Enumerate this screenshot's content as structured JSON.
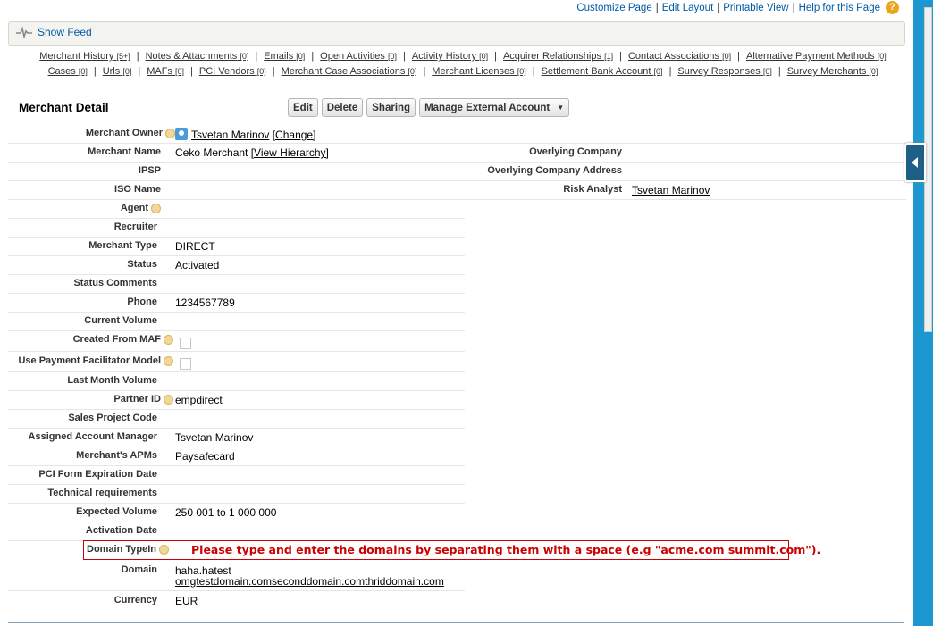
{
  "top_links": [
    "Customize Page",
    "Edit Layout",
    "Printable View",
    "Help for this Page"
  ],
  "feed": {
    "show_feed_label": "Show Feed"
  },
  "related_links_row1": [
    {
      "label": "Merchant History",
      "count": "[5+]"
    },
    {
      "label": "Notes & Attachments",
      "count": "[0]"
    },
    {
      "label": "Emails",
      "count": "[0]"
    },
    {
      "label": "Open Activities",
      "count": "[0]"
    },
    {
      "label": "Activity History",
      "count": "[0]"
    },
    {
      "label": "Acquirer Relationships",
      "count": "[1]"
    },
    {
      "label": "Contact Associations",
      "count": "[0]"
    },
    {
      "label": "Alternative Payment Methods",
      "count": "[0]"
    }
  ],
  "related_links_row2": [
    {
      "label": "Cases",
      "count": "[0]"
    },
    {
      "label": "Urls",
      "count": "[0]"
    },
    {
      "label": "MAFs",
      "count": "[0]"
    },
    {
      "label": "PCI Vendors",
      "count": "[0]"
    },
    {
      "label": "Merchant Case Associations",
      "count": "[0]"
    },
    {
      "label": "Merchant Licenses",
      "count": "[0]"
    },
    {
      "label": "Settlement Bank Account",
      "count": "[0]"
    },
    {
      "label": "Survey Responses",
      "count": "[0]"
    },
    {
      "label": "Survey Merchants",
      "count": "[0]"
    }
  ],
  "detail": {
    "title": "Merchant Detail",
    "buttons": {
      "edit": "Edit",
      "delete": "Delete",
      "sharing": "Sharing",
      "manage": "Manage External Account"
    }
  },
  "fields": {
    "owner": {
      "label": "Merchant Owner",
      "value": "Tsvetan Marinov",
      "change": "[Change]"
    },
    "name": {
      "label": "Merchant Name",
      "value": "Ceko Merchant",
      "link": "[View Hierarchy]"
    },
    "overlying_company": {
      "label": "Overlying Company",
      "value": ""
    },
    "ipsp": {
      "label": "IPSP"
    },
    "overlying_company_address": {
      "label": "Overlying Company Address"
    },
    "iso_name": {
      "label": "ISO Name"
    },
    "risk_analyst": {
      "label": "Risk Analyst",
      "value": "Tsvetan Marinov"
    },
    "agent": {
      "label": "Agent"
    },
    "recruiter": {
      "label": "Recruiter"
    },
    "merchant_type": {
      "label": "Merchant Type",
      "value": "DIRECT"
    },
    "status": {
      "label": "Status",
      "value": "Activated"
    },
    "status_comments": {
      "label": "Status Comments"
    },
    "phone": {
      "label": "Phone",
      "value": "1234567789"
    },
    "current_volume": {
      "label": "Current Volume"
    },
    "created_from_maf": {
      "label": "Created From MAF",
      "checked": false
    },
    "use_pf_model": {
      "label": "Use Payment Facilitator Model",
      "checked": false
    },
    "last_month_volume": {
      "label": "Last Month Volume"
    },
    "partner_id": {
      "label": "Partner ID",
      "value": "empdirect"
    },
    "sales_project_code": {
      "label": "Sales Project Code"
    },
    "account_manager": {
      "label": "Assigned Account Manager",
      "value": "Tsvetan Marinov"
    },
    "merchant_apms": {
      "label": "Merchant's APMs",
      "value": "Paysafecard"
    },
    "pci_form_expiration": {
      "label": "PCI Form Expiration Date"
    },
    "technical_requirements": {
      "label": "Technical requirements"
    },
    "expected_volume": {
      "label": "Expected Volume",
      "value": "250 001 to 1 000 000"
    },
    "activation_date": {
      "label": "Activation Date"
    },
    "domain_typein": {
      "label": "Domain TypeIn",
      "message": "Please type and enter the domains by separating them with a space (e.g \"acme.com summit.com\")."
    },
    "domain": {
      "label": "Domain",
      "value_line1": "haha.hatest",
      "value_line2": "omgtestdomain.comseconddomain.comthriddomain.com"
    },
    "currency": {
      "label": "Currency",
      "value": "EUR"
    }
  },
  "colors": {
    "link": "#015ba7",
    "error": "#cc0000",
    "scrollbar": "#1d97d0"
  }
}
